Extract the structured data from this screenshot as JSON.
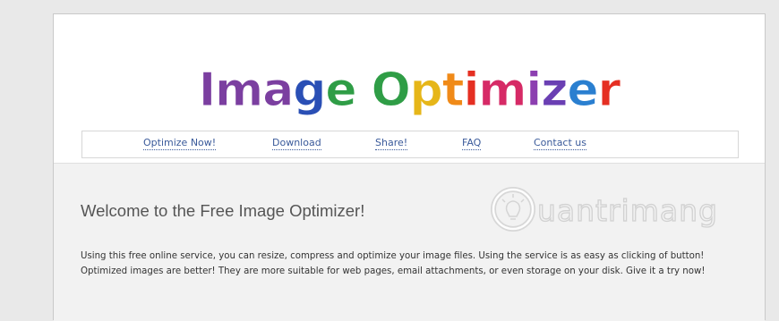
{
  "logo": {
    "text": "Image Optimizer",
    "letters": [
      {
        "ch": "I",
        "color": "#7b3fa0"
      },
      {
        "ch": "m",
        "color": "#7b3fa0"
      },
      {
        "ch": "a",
        "color": "#7b3fa0"
      },
      {
        "ch": "g",
        "color": "#2a4fb5"
      },
      {
        "ch": "e",
        "color": "#2f9d46"
      },
      {
        "ch": " ",
        "color": "#ffffff"
      },
      {
        "ch": "O",
        "color": "#2f9d46"
      },
      {
        "ch": "p",
        "color": "#e6b619"
      },
      {
        "ch": "t",
        "color": "#f08a18"
      },
      {
        "ch": "i",
        "color": "#e52f22"
      },
      {
        "ch": "m",
        "color": "#d62a66"
      },
      {
        "ch": "i",
        "color": "#8c3fb0"
      },
      {
        "ch": "z",
        "color": "#6a3fb3"
      },
      {
        "ch": "e",
        "color": "#2a7fd0"
      },
      {
        "ch": "r",
        "color": "#e52f22"
      }
    ]
  },
  "nav": {
    "items": [
      {
        "label": "Optimize Now!"
      },
      {
        "label": "Download"
      },
      {
        "label": "Share!"
      },
      {
        "label": "FAQ"
      },
      {
        "label": "Contact us"
      }
    ]
  },
  "main": {
    "title": "Welcome to the Free Image Optimizer!",
    "body": "Using this free online service, you can resize, compress and optimize your image files. Using the service is as easy as clicking of button! Optimized images are better! They are more suitable for web pages, email attachments, or even storage on your disk. Give it a try now!"
  },
  "watermark": {
    "text": "uantrimang"
  },
  "colors": {
    "nav_link": "#3a5a9a",
    "page_bg": "#f2f2f2",
    "outer_bg": "#e9e9e9"
  }
}
